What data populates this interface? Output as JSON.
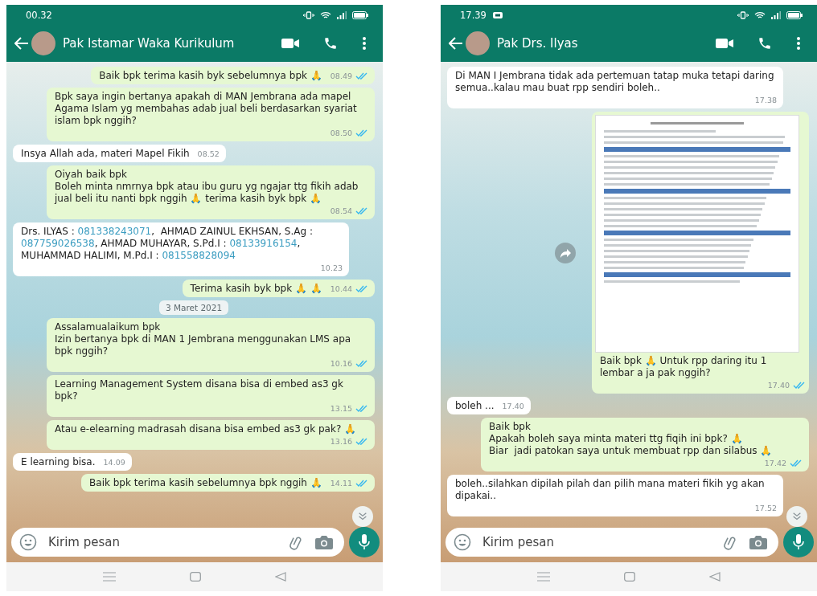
{
  "phones": [
    {
      "status_bar": {
        "time": "00.32",
        "notification": false
      },
      "header": {
        "name": "Pak Istamar Waka Kurikulum"
      },
      "messages": [
        {
          "kind": "out",
          "text": "Baik bpk terima kasih byk sebelumnya bpk 🙏",
          "time": "08.49",
          "read": true
        },
        {
          "kind": "out",
          "text": "Bpk saya ingin bertanya apakah di MAN Jembrana ada mapel Agama Islam yg membahas adab jual beli berdasarkan syariat islam bpk nggih?",
          "time": "08.50",
          "read": true
        },
        {
          "kind": "in",
          "text": "Insya Allah ada, materi Mapel Fikih",
          "time": "08.52"
        },
        {
          "kind": "out",
          "text": "Oiyah baik bpk\nBoleh minta nmrnya bpk atau ibu guru yg ngajar ttg fikih adab jual beli itu nanti bpk nggih 🙏 terima kasih byk bpk 🙏",
          "time": "08.54",
          "read": true
        },
        {
          "kind": "in",
          "parts": [
            {
              "kind": "text",
              "text": "Drs. ILYAS : "
            },
            {
              "kind": "phone",
              "text": "081338243071"
            },
            {
              "kind": "text",
              "text": ",  AHMAD ZAINUL EKHSAN, S.Ag : "
            },
            {
              "kind": "phone",
              "text": "087759026538"
            },
            {
              "kind": "text",
              "text": ", AHMAD MUHAYAR, S.Pd.I : "
            },
            {
              "kind": "phone",
              "text": "08133916154"
            },
            {
              "kind": "text",
              "text": ", MUHAMMAD HALIMI, M.Pd.I : "
            },
            {
              "kind": "phone",
              "text": "081558828094"
            }
          ],
          "time": "10.23"
        },
        {
          "kind": "out",
          "text": "Terima kasih byk bpk 🙏 🙏",
          "time": "10.44",
          "read": true
        },
        {
          "kind": "date",
          "text": "3 Maret 2021"
        },
        {
          "kind": "out",
          "text": "Assalamualaikum bpk\nIzin bertanya bpk di MAN 1 Jembrana menggunakan LMS apa bpk nggih?",
          "time": "10.16",
          "read": true
        },
        {
          "kind": "out",
          "text": "Learning Management System disana bisa di embed as3 gk bpk?",
          "time": "13.15",
          "read": true
        },
        {
          "kind": "out",
          "text": "Atau e-elearning madrasah disana bisa embed as3 gk pak? 🙏",
          "time": "13.16",
          "read": true
        },
        {
          "kind": "in",
          "text": "E learning bisa.",
          "time": "14.09"
        },
        {
          "kind": "out",
          "text": "Baik bpk terima kasih sebelumnya bpk nggih 🙏",
          "time": "14.11",
          "read": true
        }
      ],
      "input": {
        "placeholder": "Kirim pesan"
      }
    },
    {
      "status_bar": {
        "time": "17.39",
        "notification": true
      },
      "header": {
        "name": "Pak Drs. Ilyas"
      },
      "messages": [
        {
          "kind": "in",
          "text": "Di MAN I Jembrana tidak ada pertemuan tatap muka tetapi daring semua..kalau mau buat rpp sendiri boleh..",
          "time": "17.38"
        },
        {
          "kind": "image",
          "text": "Baik bpk 🙏 Untuk rpp daring itu 1 lembar a ja pak nggih?",
          "time": "17.40",
          "read": true
        },
        {
          "kind": "in",
          "text": "boleh ...",
          "time": "17.40"
        },
        {
          "kind": "out",
          "text": "Baik bpk\nApakah boleh saya minta materi ttg fiqih ini bpk? 🙏\nBiar  jadi patokan saya untuk membuat rpp dan silabus 🙏",
          "time": "17.42",
          "read": true
        },
        {
          "kind": "in",
          "text": "boleh..silahkan dipilah pilah dan pilih mana materi fikih yg akan dipakai..",
          "time": "17.52"
        }
      ],
      "input": {
        "placeholder": "Kirim pesan"
      }
    }
  ]
}
